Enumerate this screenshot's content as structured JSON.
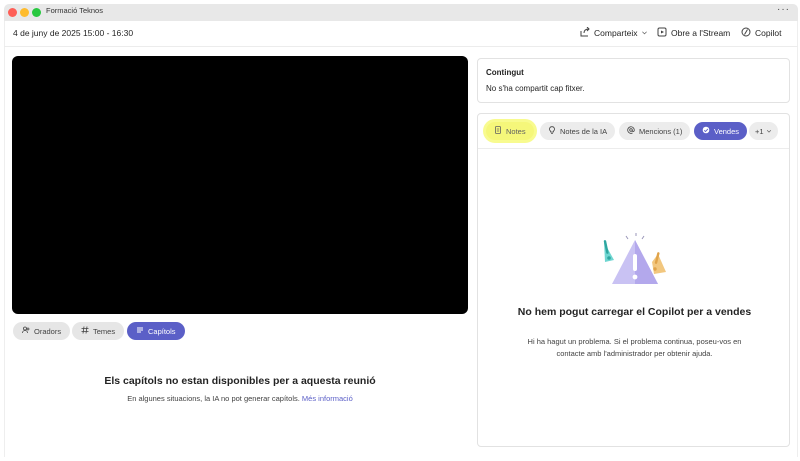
{
  "window": {
    "title": "Formació Teknos",
    "more_label": "···"
  },
  "header": {
    "date": "4 de juny de 2025 15:00 - 16:30",
    "share_label": "Comparteix",
    "stream_label": "Obre a l'Stream",
    "copilot_label": "Copilot"
  },
  "video_tabs": [
    {
      "label": "Oradors",
      "icon": "people-icon"
    },
    {
      "label": "Temes",
      "icon": "hashtag-icon"
    },
    {
      "label": "Capítols",
      "icon": "list-icon",
      "active": true
    }
  ],
  "chapters": {
    "title": "Els capítols no estan disponibles per a aquesta reunió",
    "description": "En algunes situacions, la IA no pot generar capítols.",
    "link": "Més informació"
  },
  "content": {
    "title": "Contingut",
    "text": "No s'ha compartit cap fitxer."
  },
  "panel_tabs": [
    {
      "label": "Notes",
      "icon": "notes-icon",
      "highlighted": true
    },
    {
      "label": "Notes de la IA",
      "icon": "lightbulb-icon"
    },
    {
      "label": "Mencions (1)",
      "icon": "at-icon"
    },
    {
      "label": "Vendes",
      "icon": "sales-icon",
      "active": true
    },
    {
      "label": "+1",
      "icon": "chevron-down-icon"
    }
  ],
  "error": {
    "title": "No hem pogut carregar el Copilot per a vendes",
    "description": "Hi ha hagut un problema. Si el problema continua, poseu-vos en contacte amb l'administrador per obtenir ajuda."
  },
  "colors": {
    "accent": "#5b5fc7",
    "highlight": "#f5f77a"
  }
}
